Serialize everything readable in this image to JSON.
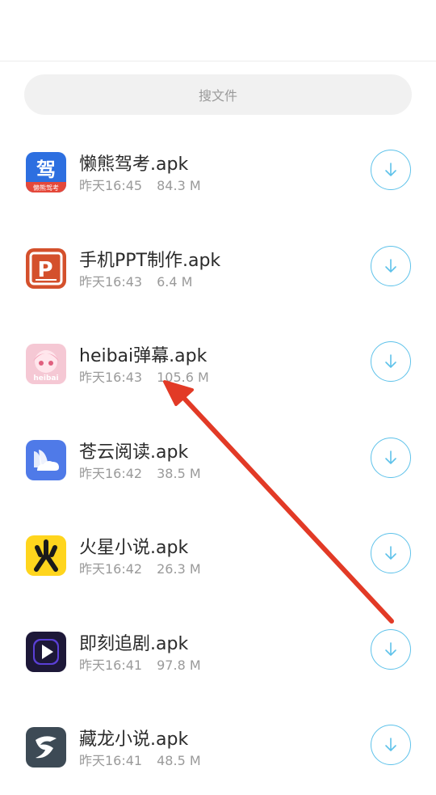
{
  "search": {
    "placeholder": "搜文件"
  },
  "files": [
    {
      "name": "懒熊驾考.apk",
      "time": "昨天16:45",
      "size": "84.3 M",
      "icon": "lazy-bear-driving-icon",
      "color": "#2d6fe0"
    },
    {
      "name": "手机PPT制作.apk",
      "time": "昨天16:43",
      "size": "6.4 M",
      "icon": "ppt-icon",
      "color": "#d4502c"
    },
    {
      "name": "heibai弹幕.apk",
      "time": "昨天16:43",
      "size": "105.6 M",
      "icon": "anime-girl-icon",
      "color": "#f5c8d4"
    },
    {
      "name": "苍云阅读.apk",
      "time": "昨天16:42",
      "size": "38.5 M",
      "icon": "cloud-reading-icon",
      "color": "#4f7ae8"
    },
    {
      "name": "火星小说.apk",
      "time": "昨天16:42",
      "size": "26.3 M",
      "icon": "mars-novel-icon",
      "color": "#ffd51d"
    },
    {
      "name": "即刻追剧.apk",
      "time": "昨天16:41",
      "size": "97.8 M",
      "icon": "play-icon",
      "color": "#1d1838"
    },
    {
      "name": "藏龙小说.apk",
      "time": "昨天16:41",
      "size": "48.5 M",
      "icon": "dragon-novel-icon",
      "color": "#3d4a55"
    }
  ],
  "colors": {
    "download_ring": "#5ec2ea",
    "annotation_arrow": "#e23a26"
  }
}
